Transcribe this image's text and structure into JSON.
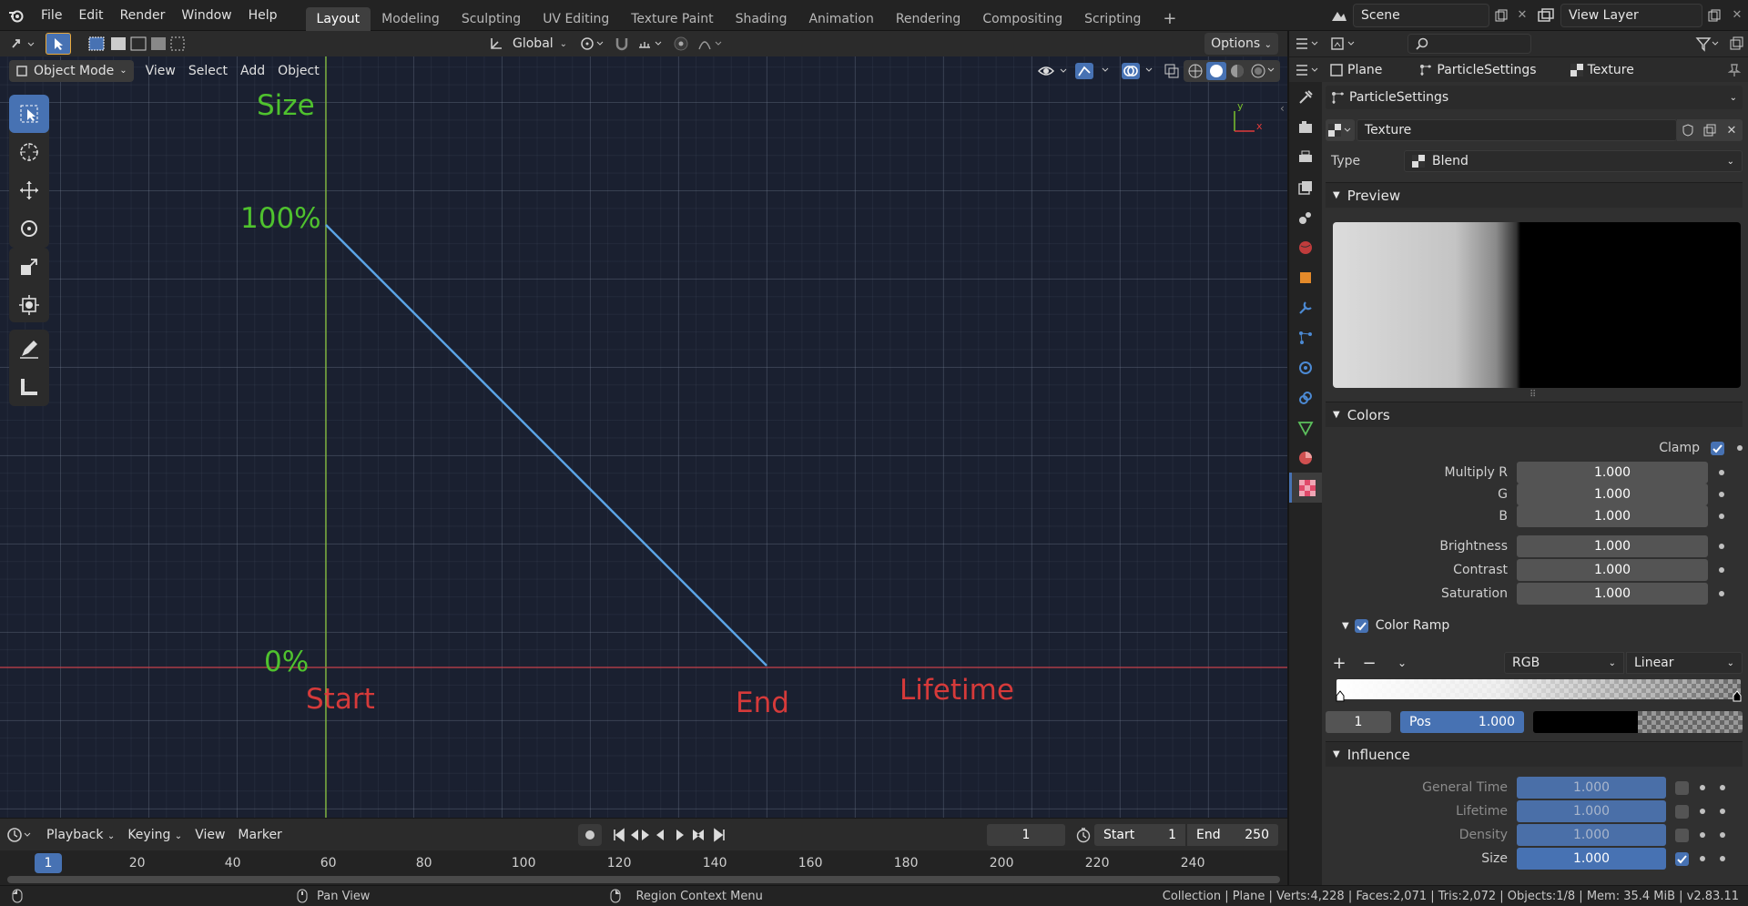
{
  "menu": {
    "file": "File",
    "edit": "Edit",
    "render": "Render",
    "window": "Window",
    "help": "Help"
  },
  "workspaces": [
    "Layout",
    "Modeling",
    "Sculpting",
    "UV Editing",
    "Texture Paint",
    "Shading",
    "Animation",
    "Rendering",
    "Compositing",
    "Scripting"
  ],
  "add_workspace": "+",
  "scene": "Scene",
  "view_layer": "View Layer",
  "toolbar": {
    "orientation": "Global",
    "options": "Options"
  },
  "viewport_header": {
    "mode": "Object Mode",
    "view": "View",
    "select": "Select",
    "add": "Add",
    "object": "Object"
  },
  "viewport_labels": {
    "size": "Size",
    "pct100": "100%",
    "pct0": "0%",
    "start": "Start",
    "end": "End",
    "lifetime": "Lifetime"
  },
  "axis_gizmo": {
    "y": "y",
    "x": "x"
  },
  "timeline": {
    "playback": "Playback",
    "keying": "Keying",
    "view": "View",
    "marker": "Marker",
    "current_frame": "1",
    "start_label": "Start",
    "start": "1",
    "end_label": "End",
    "end": "250",
    "playhead": "1",
    "ticks": [
      "20",
      "40",
      "60",
      "80",
      "100",
      "120",
      "140",
      "160",
      "180",
      "200",
      "220",
      "240"
    ]
  },
  "statusbar": {
    "pan": "Pan View",
    "context": "Region Context Menu",
    "info": "Collection | Plane | Verts:4,228 | Faces:2,071 | Tris:2,072 | Objects:1/8 | Mem: 35.4 MiB | v2.83.11"
  },
  "properties": {
    "breadcrumb": {
      "object": "Plane",
      "particles": "ParticleSettings",
      "texture": "Texture"
    },
    "particle_settings": "ParticleSettings",
    "texture_name": "Texture",
    "type_label": "Type",
    "type_value": "Blend",
    "preview": "Preview",
    "colors": {
      "header": "Colors",
      "clamp": "Clamp",
      "multiply_r": "Multiply R",
      "g": "G",
      "b": "B",
      "brightness": "Brightness",
      "contrast": "Contrast",
      "saturation": "Saturation",
      "multiply_r_v": "1.000",
      "g_v": "1.000",
      "b_v": "1.000",
      "brightness_v": "1.000",
      "contrast_v": "1.000",
      "saturation_v": "1.000"
    },
    "color_ramp": {
      "label": "Color Ramp",
      "mode": "RGB",
      "interp": "Linear",
      "index": "1",
      "pos_label": "Pos",
      "pos": "1.000"
    },
    "influence": {
      "header": "Influence",
      "general_time": "General Time",
      "lifetime": "Lifetime",
      "density": "Density",
      "size": "Size",
      "general_time_v": "1.000",
      "lifetime_v": "1.000",
      "density_v": "1.000",
      "size_v": "1.000"
    }
  }
}
